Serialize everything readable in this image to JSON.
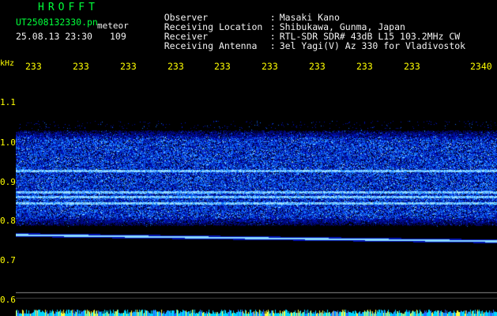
{
  "header": {
    "title": "HROFFT",
    "filename": "UT2508132330.pn",
    "type_label": "meteor",
    "datetime": "25.08.13 23:30",
    "count": "109"
  },
  "meta": [
    {
      "label": "Observer",
      "sep": ":",
      "value": "Masaki Kano"
    },
    {
      "label": "Receiving Location",
      "sep": ":",
      "value": "Shibukawa, Gunma, Japan"
    },
    {
      "label": "Receiver",
      "sep": ":",
      "value": "RTL-SDR SDR# 43dB L15 103.2MHz CW"
    },
    {
      "label": "Receiving Antenna",
      "sep": ":",
      "value": "3el Yagi(V) Az 330 for Vladivostok"
    }
  ],
  "axis": {
    "freq_unit": "kHz",
    "time_ticks": [
      "233",
      "233",
      "233",
      "233",
      "233",
      "233",
      "233",
      "233",
      "233",
      "2340"
    ],
    "freq_ticks": [
      "1.1",
      "1.0",
      "0.9",
      "0.8",
      "0.7",
      "0.6"
    ]
  },
  "colors": {
    "header_title": "#00ff3a",
    "header_text": "#f2f2f2",
    "axis_text": "#ffff00",
    "background": "#000000",
    "signal_core": "#4ff0ff",
    "signal_mid": "#1e5cff",
    "signal_low": "#0d1f9c"
  }
}
